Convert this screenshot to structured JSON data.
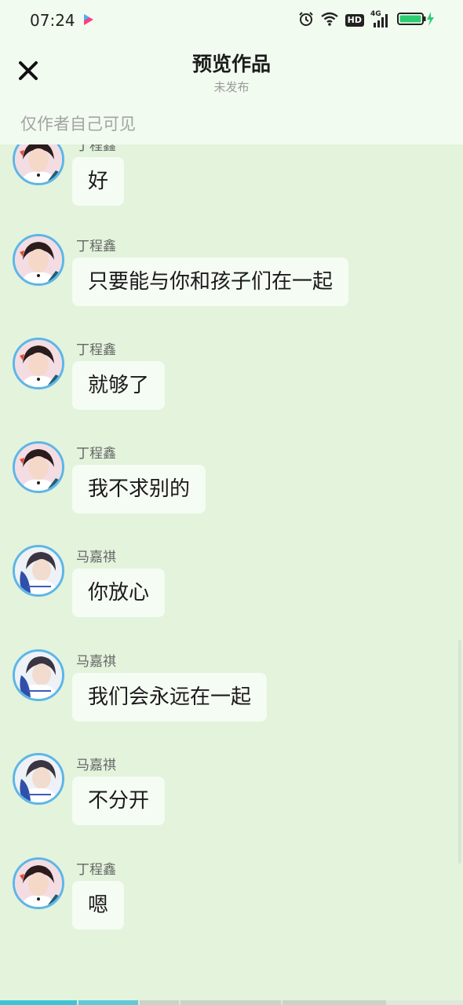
{
  "status_bar": {
    "time": "07:24",
    "icons": [
      "app-logo-icon",
      "alarm-icon",
      "wifi-icon",
      "hd-icon",
      "signal-4g-icon",
      "battery-charging-icon"
    ],
    "hd_label": "HD",
    "network_label": "4G",
    "battery_color": "#2ecc71"
  },
  "header": {
    "title": "预览作品",
    "subtitle": "未发布",
    "visibility_note": "仅作者自己可见",
    "close_icon": "close-icon"
  },
  "colors": {
    "chat_background": "#e3f3dc",
    "header_background": "#f2fbf0",
    "bubble_background": "#f5fcf3",
    "avatar_border": "#5cb6e8"
  },
  "messages": [
    {
      "sender": "丁程鑫",
      "text": "好",
      "avatar": "avatar-dingchengxin"
    },
    {
      "sender": "丁程鑫",
      "text": "只要能与你和孩子们在一起",
      "avatar": "avatar-dingchengxin"
    },
    {
      "sender": "丁程鑫",
      "text": "就够了",
      "avatar": "avatar-dingchengxin"
    },
    {
      "sender": "丁程鑫",
      "text": "我不求别的",
      "avatar": "avatar-dingchengxin"
    },
    {
      "sender": "马嘉祺",
      "text": "你放心",
      "avatar": "avatar-majiaqi"
    },
    {
      "sender": "马嘉祺",
      "text": "我们会永远在一起",
      "avatar": "avatar-majiaqi"
    },
    {
      "sender": "马嘉祺",
      "text": "不分开",
      "avatar": "avatar-majiaqi"
    },
    {
      "sender": "丁程鑫",
      "text": "嗯",
      "avatar": "avatar-dingchengxin"
    }
  ]
}
